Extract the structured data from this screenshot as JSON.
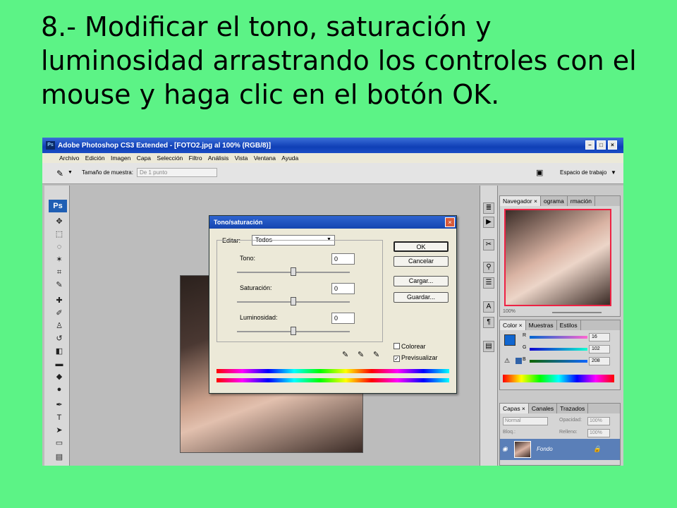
{
  "slide": {
    "title": "8.- Modificar el tono, saturación y luminosidad arrastrando los controles con el mouse y haga clic en el botón OK."
  },
  "window": {
    "title": "Adobe Photoshop CS3 Extended - [FOTO2.jpg al 100% (RGB/8)]",
    "app_icon": "Ps"
  },
  "menu": [
    "Archivo",
    "Edición",
    "Imagen",
    "Capa",
    "Selección",
    "Filtro",
    "Análisis",
    "Vista",
    "Ventana",
    "Ayuda"
  ],
  "options_bar": {
    "sample_label": "Tamaño de muestra:",
    "sample_value": "De 1 punto",
    "workspace_label": "Espacio de trabajo"
  },
  "toolbox": {
    "logo": "Ps"
  },
  "dialog": {
    "title": "Tono/saturación",
    "edit_label": "Editar:",
    "edit_value": "Todos",
    "hue_label": "Tono:",
    "hue_value": "0",
    "saturation_label": "Saturación:",
    "saturation_value": "0",
    "lightness_label": "Luminosidad:",
    "lightness_value": "0",
    "ok": "OK",
    "cancel": "Cancelar",
    "load": "Cargar...",
    "save": "Guardar...",
    "colorize": "Colorear",
    "preview": "Previsualizar",
    "preview_checked": "✓"
  },
  "navigator_panel": {
    "tabs": [
      "Navegador ×",
      "ograma",
      "rmación"
    ],
    "zoom": "100%"
  },
  "color_panel": {
    "tabs": [
      "Color ×",
      "Muestras",
      "Estilos"
    ],
    "r_label": "R",
    "r_value": "16",
    "g_label": "G",
    "g_value": "102",
    "b_label": "B",
    "b_value": "208",
    "foreground": "#1066d0"
  },
  "layers_panel": {
    "tabs": [
      "Capas ×",
      "Canales",
      "Trazados"
    ],
    "blend_mode": "Normal",
    "opacity_label": "Opacidad:",
    "opacity_value": "100%",
    "lock_label": "Bloq.:",
    "fill_label": "Relleno:",
    "fill_value": "100%",
    "layer_name": "Fondo"
  }
}
